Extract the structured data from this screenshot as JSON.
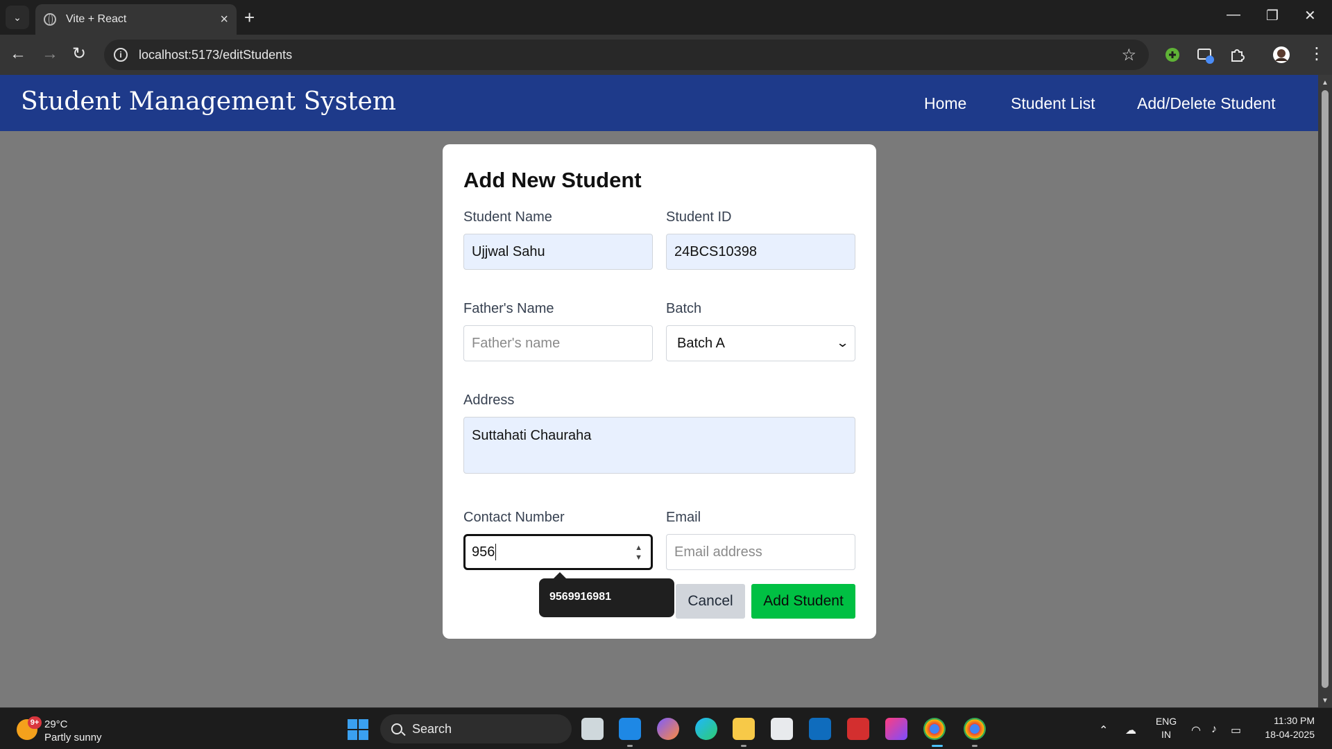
{
  "browser": {
    "tab_title": "Vite + React",
    "url": "localhost:5173/editStudents"
  },
  "app": {
    "brand": "Student Management System",
    "nav": [
      "Home",
      "Student List",
      "Add/Delete Student"
    ]
  },
  "form": {
    "title": "Add New Student",
    "student_name": {
      "label": "Student Name",
      "value": "Ujjwal Sahu"
    },
    "student_id": {
      "label": "Student ID",
      "value": "24BCS10398"
    },
    "fathers_name": {
      "label": "Father's Name",
      "placeholder": "Father's name"
    },
    "batch": {
      "label": "Batch",
      "value": "Batch A"
    },
    "address": {
      "label": "Address",
      "value": "Suttahati Chauraha"
    },
    "contact": {
      "label": "Contact Number",
      "value": "956"
    },
    "email": {
      "label": "Email",
      "placeholder": "Email address"
    },
    "cancel_label": "Cancel",
    "submit_label": "Add Student",
    "autofill_suggestion": "9569916981"
  },
  "colors": {
    "nav_bg": "#1e3a8a",
    "submit_bg": "#00c043",
    "overlay_bg": "#7a7a7a"
  },
  "taskbar": {
    "weather_badge": "9+",
    "temperature": "29°C",
    "weather": "Partly sunny",
    "search_label": "Search",
    "lang_top": "ENG",
    "lang_bottom": "IN",
    "time": "11:30 PM",
    "date": "18-04-2025"
  }
}
